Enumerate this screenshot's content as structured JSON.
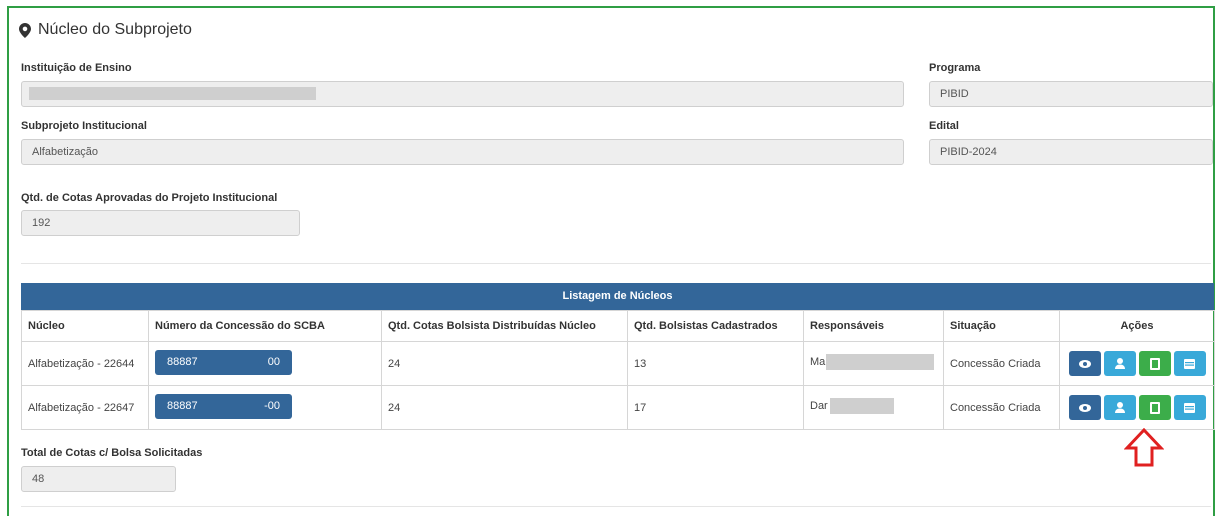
{
  "section": {
    "title": "Núcleo do Subprojeto",
    "icon": "map-marker-icon"
  },
  "fields": {
    "instituicao": {
      "label": "Instituição de Ensino",
      "value": ""
    },
    "programa": {
      "label": "Programa",
      "value": "PIBID"
    },
    "subprojeto": {
      "label": "Subprojeto Institucional",
      "value": "Alfabetização"
    },
    "edital": {
      "label": "Edital",
      "value": "PIBID-2024"
    },
    "cotas_aprovadas": {
      "label": "Qtd. de Cotas Aprovadas do Projeto Institucional",
      "value": "192"
    },
    "total_cotas": {
      "label": "Total de Cotas c/ Bolsa Solicitadas",
      "value": "48"
    }
  },
  "table": {
    "title": "Listagem de Núcleos",
    "columns": [
      "Núcleo",
      "Número da Concessão do SCBA",
      "Qtd. Cotas Bolsista Distribuídas Núcleo",
      "Qtd. Bolsistas Cadastrados",
      "Responsáveis",
      "Situação",
      "Ações"
    ],
    "rows": [
      {
        "nucleo": "Alfabetização - 22644",
        "scba_prefix": "88887",
        "scba_suffix": "00",
        "cotas": "24",
        "bolsistas": "13",
        "responsavel": "Ma",
        "situacao": "Concessão Criada"
      },
      {
        "nucleo": "Alfabetização - 22647",
        "scba_prefix": "88887",
        "scba_suffix": "-00",
        "cotas": "24",
        "bolsistas": "17",
        "responsavel": "Dar",
        "situacao": "Concessão Criada"
      }
    ],
    "actions": [
      "eye-icon",
      "user-icon",
      "document-icon",
      "calendar-icon"
    ]
  },
  "colors": {
    "accent_border": "#2f9e44",
    "table_header": "#336699",
    "btn_dark": "#336699",
    "btn_cyan": "#39a9d9",
    "btn_green": "#3cad4a",
    "highlight_arrow": "#e02020"
  }
}
